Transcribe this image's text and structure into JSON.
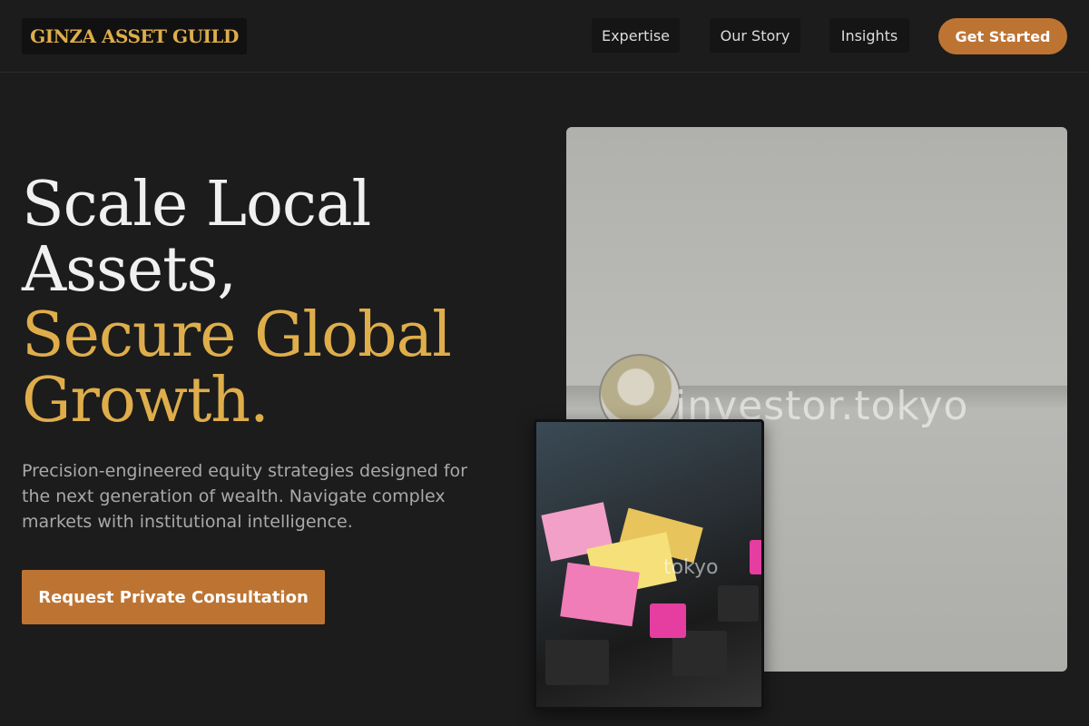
{
  "header": {
    "logo": "GINZA ASSET GUILD",
    "nav": [
      "Expertise",
      "Our Story",
      "Insights"
    ],
    "cta": "Get Started"
  },
  "hero": {
    "headline_line1": "Scale Local Assets,",
    "headline_line2": "Secure Global Growth.",
    "subtext": "Precision-engineered equity strategies designed for the next generation of wealth. Navigate complex markets with institutional intelligence.",
    "cta": "Request Private Consultation"
  },
  "images": {
    "main_watermark": "investor.tokyo",
    "small_watermark": "tokyo"
  },
  "colors": {
    "background": "#1c1c1c",
    "accent_gold": "#dfae4b",
    "accent_orange": "#bd7433"
  }
}
